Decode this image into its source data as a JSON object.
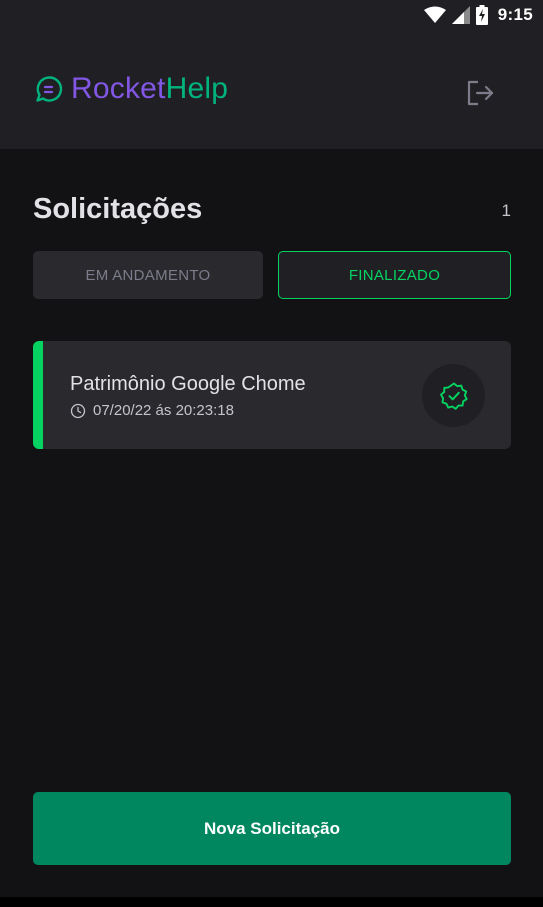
{
  "status_bar": {
    "time": "9:15",
    "icons": [
      "wifi-icon",
      "cell-signal-icon",
      "battery-charging-icon"
    ]
  },
  "header": {
    "logo_part1": "Rocket",
    "logo_part2": "Help",
    "logo_icon": "chat-bubble-icon",
    "logout_icon": "logout-icon"
  },
  "main": {
    "title": "Solicitações",
    "count": "1",
    "filters": {
      "open_label": "EM ANDAMENTO",
      "closed_label": "FINALIZADO",
      "selected": "FINALIZADO"
    },
    "requests": [
      {
        "title": "Patrimônio Google Chome",
        "datetime": "07/20/22 ás 20:23:18",
        "status_icon": "verified-check-icon"
      }
    ],
    "new_button_label": "Nova Solicitação"
  },
  "colors": {
    "background": "#121214",
    "header": "#202024",
    "card": "#29292e",
    "green_accent": "#04d361",
    "primary_button": "#00875f",
    "brand_purple": "#8257e5",
    "brand_green": "#00b37e"
  }
}
